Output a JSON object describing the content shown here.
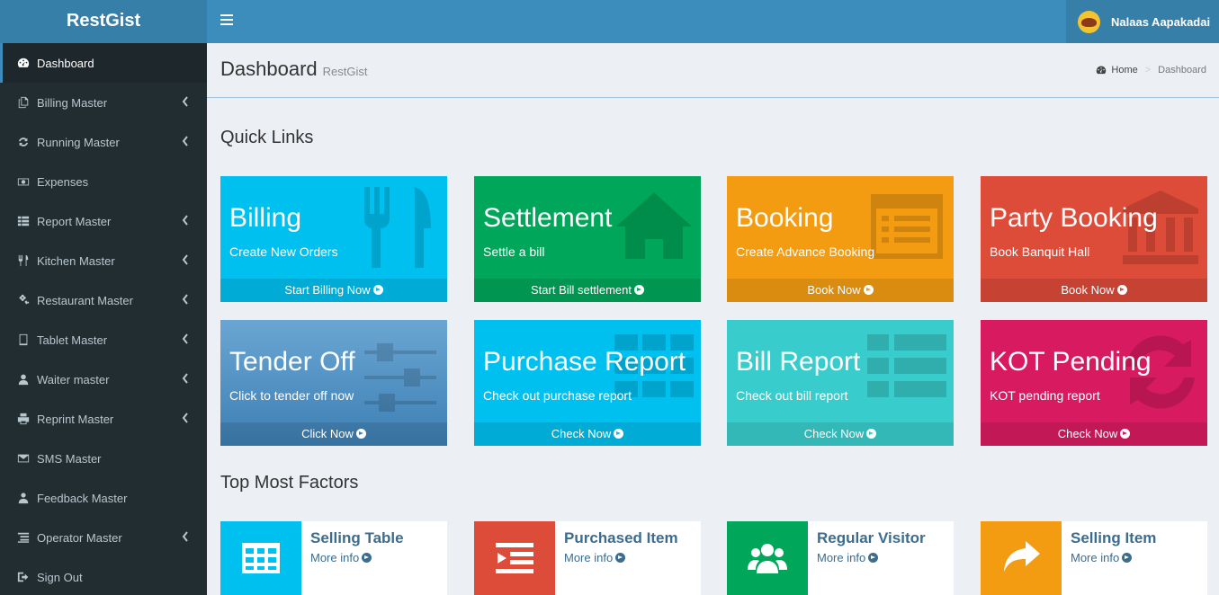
{
  "app": {
    "logo": "RestGist"
  },
  "header": {
    "user_name": "Nalaas Aapakadai"
  },
  "page": {
    "title": "Dashboard",
    "subtitle": "RestGist"
  },
  "breadcrumb": {
    "home": "Home",
    "current": "Dashboard"
  },
  "sidebar": {
    "items": [
      {
        "label": "Dashboard"
      },
      {
        "label": "Billing Master"
      },
      {
        "label": "Running Master"
      },
      {
        "label": "Expenses"
      },
      {
        "label": "Report Master"
      },
      {
        "label": "Kitchen Master"
      },
      {
        "label": "Restaurant Master"
      },
      {
        "label": "Tablet Master"
      },
      {
        "label": "Waiter master"
      },
      {
        "label": "Reprint Master"
      },
      {
        "label": "SMS Master"
      },
      {
        "label": "Feedback Master"
      },
      {
        "label": "Operator Master"
      },
      {
        "label": "Sign Out"
      }
    ]
  },
  "quick_links": {
    "title": "Quick Links",
    "cards": [
      {
        "title": "Billing",
        "desc": "Create New Orders",
        "action": "Start Billing Now",
        "color": "#00c0ef",
        "icon": "cutlery-icon"
      },
      {
        "title": "Settlement",
        "desc": "Settle a bill",
        "action": "Start Bill settlement",
        "color": "#00a65a",
        "icon": "home-icon"
      },
      {
        "title": "Booking",
        "desc": "Create Advance Booking",
        "action": "Book Now",
        "color": "#f39c12",
        "icon": "list-alt-icon"
      },
      {
        "title": "Party Booking",
        "desc": "Book Banquit Hall",
        "action": "Book Now",
        "color": "#dd4b39",
        "icon": "bank-icon"
      },
      {
        "title": "Tender Off",
        "desc": "Click to tender off now",
        "action": "Click Now",
        "color": "#4a8fc0",
        "icon": "sliders-icon"
      },
      {
        "title": "Purchase Report",
        "desc": "Check out purchase report",
        "action": "Check Now",
        "color": "#00c0ef",
        "icon": "th-icon"
      },
      {
        "title": "Bill Report",
        "desc": "Check out bill report",
        "action": "Check Now",
        "color": "#39cccc",
        "icon": "th-list-icon"
      },
      {
        "title": "KOT Pending",
        "desc": "KOT pending report",
        "action": "Check Now",
        "color": "#d81b60",
        "icon": "refresh-icon"
      }
    ]
  },
  "top_factors": {
    "title": "Top Most Factors",
    "items": [
      {
        "title": "Selling Table",
        "more": "More info",
        "color": "#00c0ef",
        "icon": "table-icon"
      },
      {
        "title": "Purchased Item",
        "more": "More info",
        "color": "#dd4b39",
        "icon": "indent-icon"
      },
      {
        "title": "Regular Visitor",
        "more": "More info",
        "color": "#00a65a",
        "icon": "users-icon"
      },
      {
        "title": "Selling Item",
        "more": "More info",
        "color": "#f39c12",
        "icon": "share-icon"
      }
    ]
  }
}
